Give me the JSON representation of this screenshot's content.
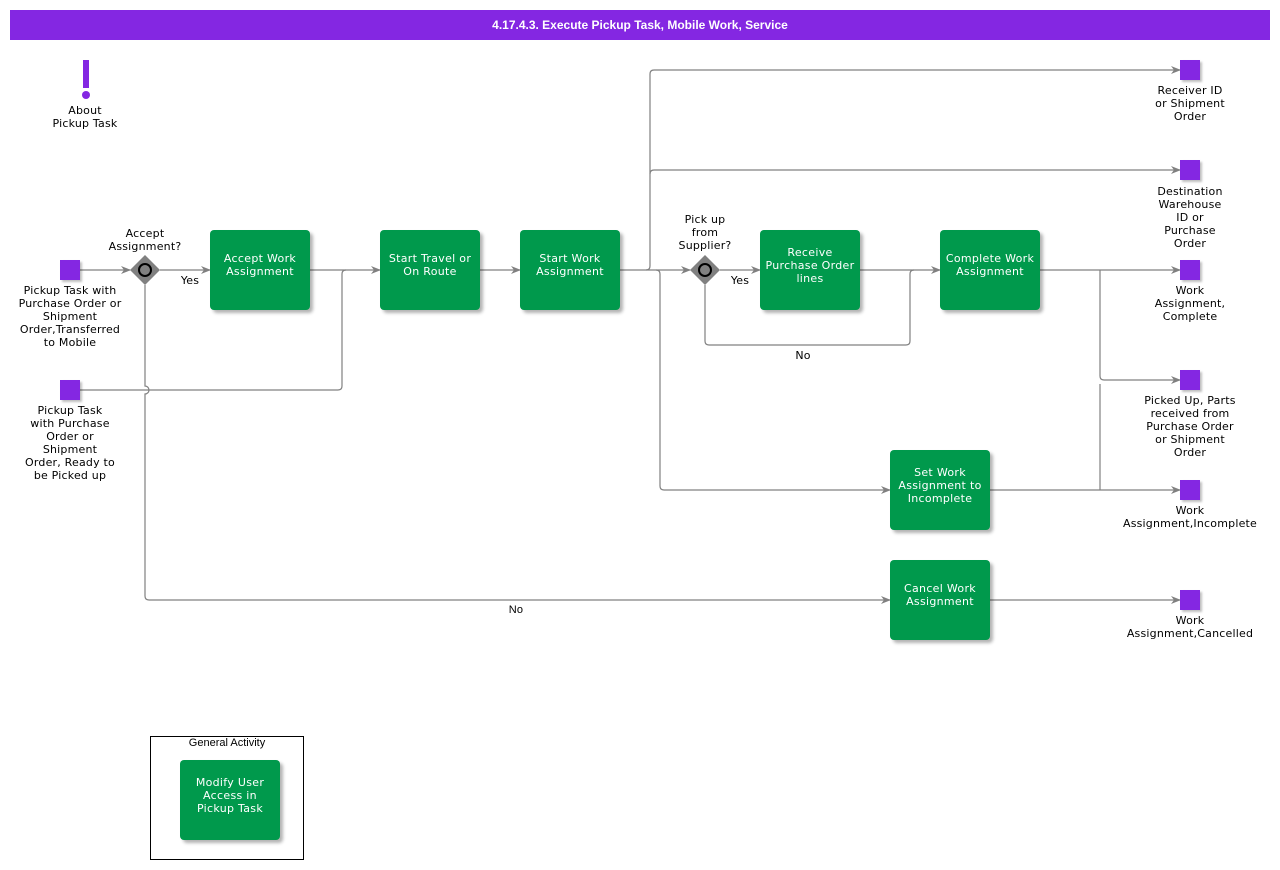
{
  "title": "4.17.4.3. Execute Pickup Task, Mobile Work, Service",
  "colors": {
    "header": "#8427e2",
    "task": "#00994c",
    "event": "#8427e2",
    "gateway": "#808080",
    "connector": "#808080"
  },
  "annotation": {
    "icon": "exclamation-icon",
    "label": "About\nPickup Task"
  },
  "start_events": [
    {
      "label": "Pickup Task with\nPurchase Order or\nShipment\nOrder,Transferred\nto Mobile"
    },
    {
      "label": "Pickup Task\nwith Purchase\nOrder or\nShipment\nOrder, Ready to\nbe Picked up"
    }
  ],
  "gateways": [
    {
      "label": "Accept\nAssignment?",
      "yes": "Yes",
      "no": "No"
    },
    {
      "label": "Pick up\nfrom\nSupplier?",
      "yes": "Yes",
      "no": "No"
    }
  ],
  "tasks": {
    "accept": "Accept Work Assignment",
    "travel": "Start Travel or On Route",
    "start": "Start Work Assignment",
    "receive": "Receive Purchase Order lines",
    "complete": "Complete Work Assignment",
    "incomplete": "Set Work Assignment to Incomplete",
    "cancel": "Cancel Work Assignment"
  },
  "end_events": [
    {
      "label": "Receiver ID\nor Shipment\nOrder"
    },
    {
      "label": "Destination\nWarehouse\nID or\nPurchase\nOrder"
    },
    {
      "label": "Work\nAssignment,\nComplete"
    },
    {
      "label": "Picked Up, Parts\nreceived from\nPurchase Order\nor Shipment\nOrder"
    },
    {
      "label": "Work\nAssignment,Incomplete"
    },
    {
      "label": "Work\nAssignment,Cancelled"
    }
  ],
  "general_activity": {
    "title": "General Activity",
    "task": "Modify User Access in Pickup Task"
  }
}
